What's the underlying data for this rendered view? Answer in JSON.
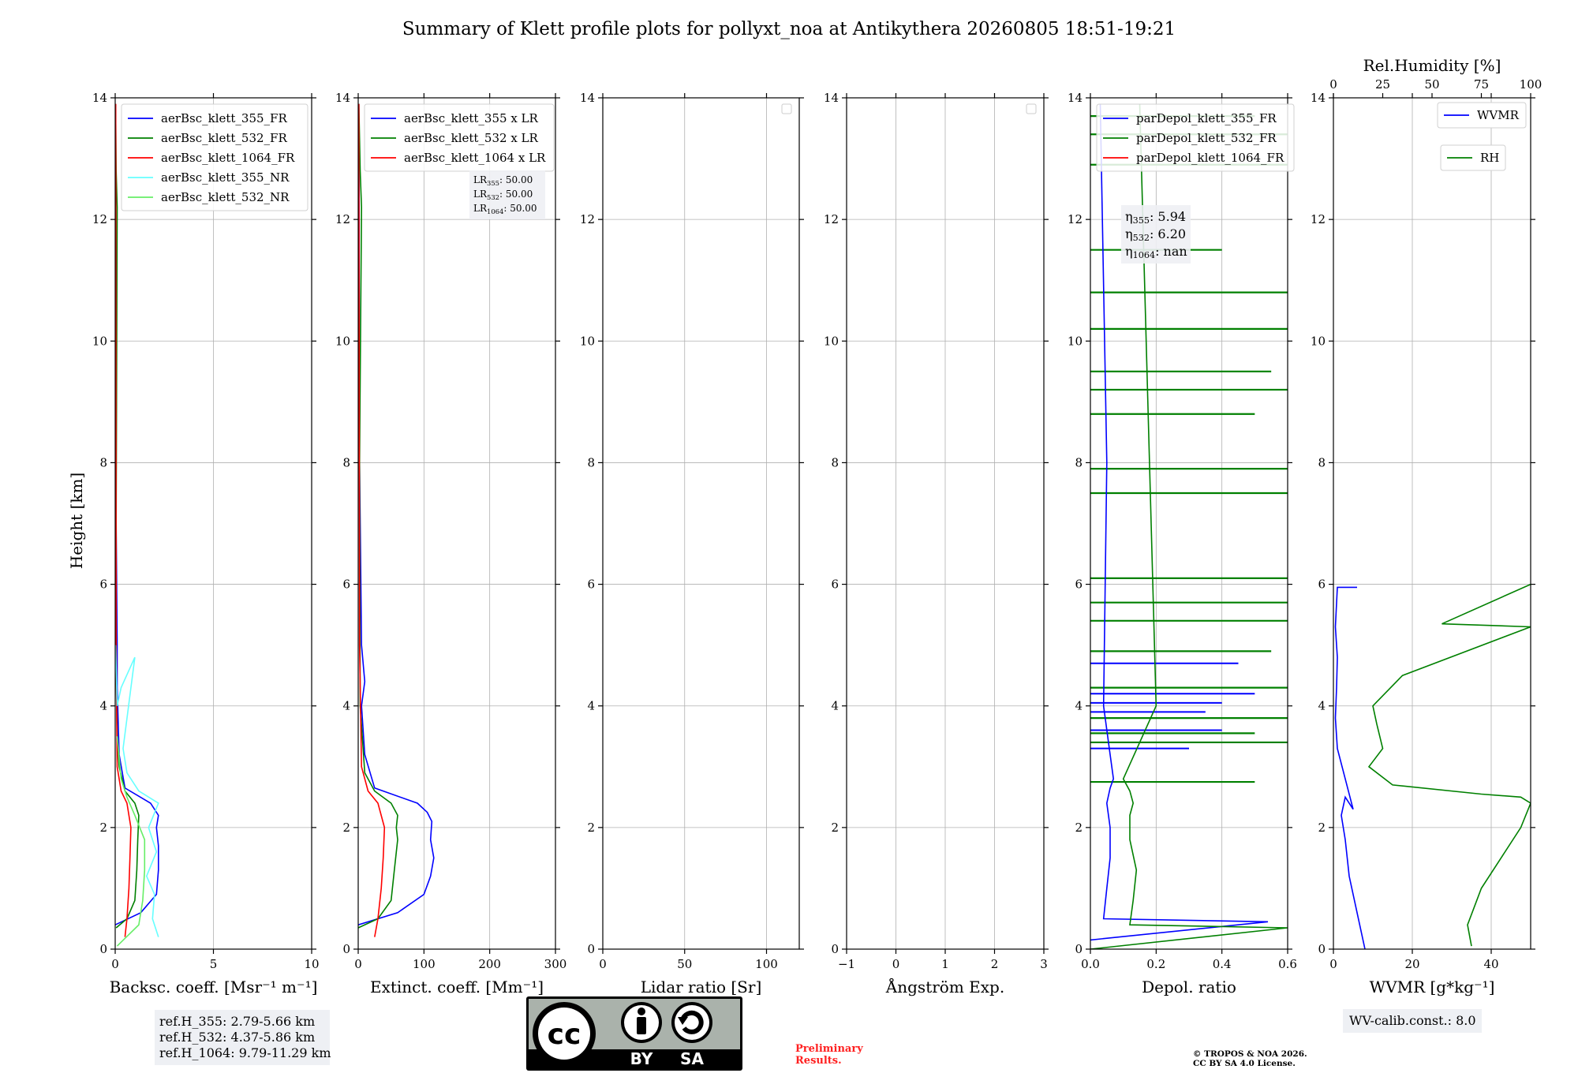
{
  "title": "Summary of Klett profile plots for pollyxt_noa at Antikythera 20260805 18:51-19:21",
  "ylabel": "Height [km]",
  "colors": {
    "blue": "#0000ff",
    "green": "#008000",
    "red": "#ff0000",
    "cyan": "#66ffff",
    "lightgreen": "#66ee66"
  },
  "chart_data": [
    {
      "type": "line",
      "xlabel": "Backsc. coeff. [Msr⁻¹ m⁻¹]",
      "xlim": [
        0,
        10
      ],
      "ylim": [
        0,
        14
      ],
      "xticks": [
        0,
        5,
        10
      ],
      "yticks": [
        0,
        2,
        4,
        6,
        8,
        10,
        12,
        14
      ],
      "legend": "top-left",
      "series": [
        {
          "name": "aerBsc_klett_355_FR",
          "color": "#0000ff",
          "x": [
            0.0,
            1.3,
            2.1,
            2.2,
            2.2,
            2.1,
            2.2,
            1.8,
            0.5,
            0.2,
            0.1,
            0.1,
            0.05,
            0.03,
            0.02,
            0.01
          ],
          "y": [
            0.4,
            0.6,
            0.9,
            1.3,
            1.7,
            2.0,
            2.2,
            2.4,
            2.65,
            3.2,
            4.3,
            5.0,
            7.0,
            10.0,
            12.0,
            13.9
          ]
        },
        {
          "name": "aerBsc_klett_532_FR",
          "color": "#008000",
          "x": [
            0.05,
            0.6,
            1.0,
            1.1,
            1.15,
            1.2,
            1.0,
            0.5,
            0.2,
            0.1,
            0.05,
            0.05,
            0.1,
            0.05,
            0.02
          ],
          "y": [
            0.35,
            0.5,
            0.8,
            1.3,
            1.8,
            2.2,
            2.4,
            2.6,
            3.0,
            3.5,
            4.5,
            7.0,
            12.2,
            12.8,
            13.9
          ]
        },
        {
          "name": "aerBsc_klett_1064_FR",
          "color": "#ff0000",
          "x": [
            0.5,
            0.6,
            0.7,
            0.75,
            0.8,
            0.6,
            0.3,
            0.1,
            0.05,
            0.03
          ],
          "y": [
            0.2,
            0.5,
            1.0,
            1.5,
            2.0,
            2.4,
            2.6,
            3.0,
            5.0,
            13.9
          ]
        },
        {
          "name": "aerBsc_klett_355_NR",
          "color": "#66ffff",
          "x": [
            2.2,
            1.9,
            2.0,
            1.6,
            2.1,
            1.7,
            2.2,
            1.2,
            0.6,
            0.4,
            1.0,
            0.3,
            0.1,
            0.02
          ],
          "y": [
            0.2,
            0.5,
            0.9,
            1.2,
            1.6,
            2.0,
            2.4,
            2.6,
            2.9,
            3.3,
            4.8,
            4.3,
            4.0,
            5.0
          ]
        },
        {
          "name": "aerBsc_klett_532_NR",
          "color": "#66ee66",
          "x": [
            0.1,
            1.2,
            1.4,
            1.5,
            1.5,
            1.0,
            0.6,
            0.3,
            0.1
          ],
          "y": [
            0.05,
            0.4,
            0.8,
            1.3,
            1.8,
            2.2,
            2.5,
            2.8,
            3.5
          ]
        }
      ]
    },
    {
      "type": "line",
      "xlabel": "Extinct. coeff. [Mm⁻¹]",
      "xlim": [
        0,
        300
      ],
      "ylim": [
        0,
        14
      ],
      "xticks": [
        0,
        100,
        200,
        300
      ],
      "yticks": [
        0,
        2,
        4,
        6,
        8,
        10,
        12,
        14
      ],
      "legend": "top-left",
      "annotation": [
        {
          "label": "LR",
          "sub": "355",
          "value": ": 50.00"
        },
        {
          "label": "LR",
          "sub": "532",
          "value": ": 50.00"
        },
        {
          "label": "LR",
          "sub": "1064",
          "value": ": 50.00"
        }
      ],
      "series": [
        {
          "name": "aerBsc_klett_355 x LR",
          "color": "#0000ff",
          "x": [
            0,
            60,
            100,
            110,
            115,
            110,
            112,
            105,
            90,
            25,
            10,
            5,
            10,
            5,
            2,
            1
          ],
          "y": [
            0.4,
            0.6,
            0.9,
            1.2,
            1.5,
            1.8,
            2.1,
            2.25,
            2.4,
            2.65,
            3.2,
            4.0,
            4.4,
            5.0,
            8.0,
            13.9
          ]
        },
        {
          "name": "aerBsc_klett_532 x LR",
          "color": "#008000",
          "x": [
            0,
            30,
            50,
            55,
            60,
            58,
            60,
            50,
            25,
            10,
            3,
            2,
            5,
            3,
            1
          ],
          "y": [
            0.35,
            0.5,
            0.8,
            1.3,
            1.8,
            2.0,
            2.2,
            2.4,
            2.6,
            2.9,
            4.0,
            8.0,
            12.2,
            12.8,
            13.9
          ]
        },
        {
          "name": "aerBsc_klett_1064 x LR",
          "color": "#ff0000",
          "x": [
            25,
            30,
            35,
            38,
            40,
            30,
            15,
            5,
            2,
            1
          ],
          "y": [
            0.2,
            0.5,
            1.0,
            1.5,
            2.0,
            2.4,
            2.6,
            3.0,
            5.0,
            13.9
          ]
        }
      ]
    },
    {
      "type": "line",
      "xlabel": "Lidar ratio [Sr]",
      "xlim": [
        0,
        120
      ],
      "ylim": [
        0,
        14
      ],
      "xticks": [
        0,
        50,
        100
      ],
      "yticks": [
        0,
        2,
        4,
        6,
        8,
        10,
        12,
        14
      ],
      "legend": "top-right",
      "series": []
    },
    {
      "type": "line",
      "xlabel": "Ångström Exp.",
      "xlim": [
        -1,
        3
      ],
      "ylim": [
        0,
        14
      ],
      "xticks": [
        -1,
        0,
        1,
        2,
        3
      ],
      "yticks": [
        0,
        2,
        4,
        6,
        8,
        10,
        12,
        14
      ],
      "legend": "top-right",
      "series": []
    },
    {
      "type": "line",
      "xlabel": "Depol. ratio",
      "xlim": [
        0,
        0.6
      ],
      "ylim": [
        0,
        14
      ],
      "xticks": [
        0.0,
        0.2,
        0.4,
        0.6
      ],
      "yticks": [
        0,
        2,
        4,
        6,
        8,
        10,
        12,
        14
      ],
      "legend": "top-left",
      "annotation": [
        {
          "label": "η",
          "sub": "355",
          "value": ": 5.94"
        },
        {
          "label": "η",
          "sub": "532",
          "value": ": 6.20"
        },
        {
          "label": "η",
          "sub": "1064",
          "value": ": nan"
        }
      ],
      "series": [
        {
          "name": "parDepol_klett_355_FR",
          "color": "#0000ff",
          "x": [
            0.0,
            0.54,
            0.04,
            0.05,
            0.06,
            0.06,
            0.05,
            0.06,
            0.07,
            0.06,
            0.04,
            0.05,
            0.03
          ],
          "y": [
            0.15,
            0.45,
            0.5,
            1.0,
            1.5,
            2.0,
            2.4,
            2.65,
            2.8,
            3.2,
            4.0,
            8.0,
            13.9
          ]
        },
        {
          "name": "parDepol_klett_532_FR",
          "color": "#008000",
          "x": [
            0.0,
            0.6,
            0.12,
            0.13,
            0.14,
            0.12,
            0.12,
            0.13,
            0.12,
            0.1,
            0.2,
            0.15
          ],
          "y": [
            0.0,
            0.35,
            0.4,
            0.8,
            1.3,
            1.8,
            2.2,
            2.4,
            2.6,
            2.8,
            4.0,
            13.9
          ]
        },
        {
          "name": "parDepol_klett_1064_FR",
          "color": "#ff0000",
          "x": [],
          "y": []
        }
      ],
      "spikes_355": [
        [
          0.4,
          4.05
        ],
        [
          0.5,
          4.2
        ],
        [
          0.45,
          4.7
        ],
        [
          0.3,
          3.3
        ],
        [
          0.35,
          3.9
        ],
        [
          0.4,
          3.6
        ]
      ],
      "spikes_532": [
        [
          0.6,
          6.1
        ],
        [
          0.6,
          5.7
        ],
        [
          0.6,
          5.4
        ],
        [
          0.55,
          4.9
        ],
        [
          0.6,
          4.3
        ],
        [
          0.6,
          3.8
        ],
        [
          0.5,
          3.55
        ],
        [
          0.6,
          3.4
        ],
        [
          0.5,
          2.75
        ],
        [
          0.6,
          7.5
        ],
        [
          0.6,
          7.9
        ],
        [
          0.5,
          8.8
        ],
        [
          0.6,
          9.2
        ],
        [
          0.55,
          9.5
        ],
        [
          0.6,
          10.2
        ],
        [
          0.6,
          10.8
        ],
        [
          0.4,
          11.5
        ],
        [
          0.6,
          12.9
        ],
        [
          0.6,
          13.4
        ],
        [
          0.5,
          13.7
        ]
      ]
    },
    {
      "type": "line",
      "xlabel": "WVMR [g*kg⁻¹]",
      "xlabel_top": "Rel.Humidity [%]",
      "xlim": [
        0,
        50
      ],
      "ylim": [
        0,
        14
      ],
      "xlim_top": [
        0,
        100
      ],
      "xticks": [
        0,
        20,
        40
      ],
      "xticks_top": [
        0,
        25,
        50,
        75,
        100
      ],
      "yticks": [
        0,
        2,
        4,
        6,
        8,
        10,
        12,
        14
      ],
      "legend": "top-right",
      "annotation_text": "WV-calib.const.: 8.0",
      "series": [
        {
          "name": "WVMR",
          "color": "#0000ff",
          "x": [
            8,
            6,
            4,
            3,
            2,
            3,
            5,
            3,
            1,
            0.5,
            0.8,
            1,
            0.5,
            1,
            6
          ],
          "y": [
            0.0,
            0.6,
            1.2,
            1.8,
            2.2,
            2.5,
            2.3,
            2.8,
            3.3,
            3.8,
            4.3,
            4.8,
            5.3,
            5.95,
            5.95
          ]
        },
        {
          "name": "RH",
          "color": "#008000",
          "x": [
            70,
            68,
            75,
            85,
            95,
            100,
            95,
            75,
            30,
            18,
            25,
            22,
            20,
            35,
            100,
            55,
            100
          ],
          "y": [
            0.05,
            0.4,
            1.0,
            1.5,
            2.0,
            2.4,
            2.5,
            2.55,
            2.7,
            3.0,
            3.3,
            3.7,
            4.0,
            4.5,
            5.3,
            5.35,
            6.0
          ]
        }
      ]
    }
  ],
  "footer": {
    "ref_lines": [
      "ref.H_355: 2.79-5.66 km",
      "ref.H_532: 4.37-5.86 km",
      "ref.H_1064: 9.79-11.29 km"
    ],
    "license_badge": {
      "cc": "cc",
      "by": "BY",
      "sa": "SA"
    },
    "preliminary": [
      "Preliminary",
      "Results."
    ],
    "copyright": [
      "© TROPOS & NOA 2026.",
      "CC BY SA 4.0 License."
    ]
  }
}
